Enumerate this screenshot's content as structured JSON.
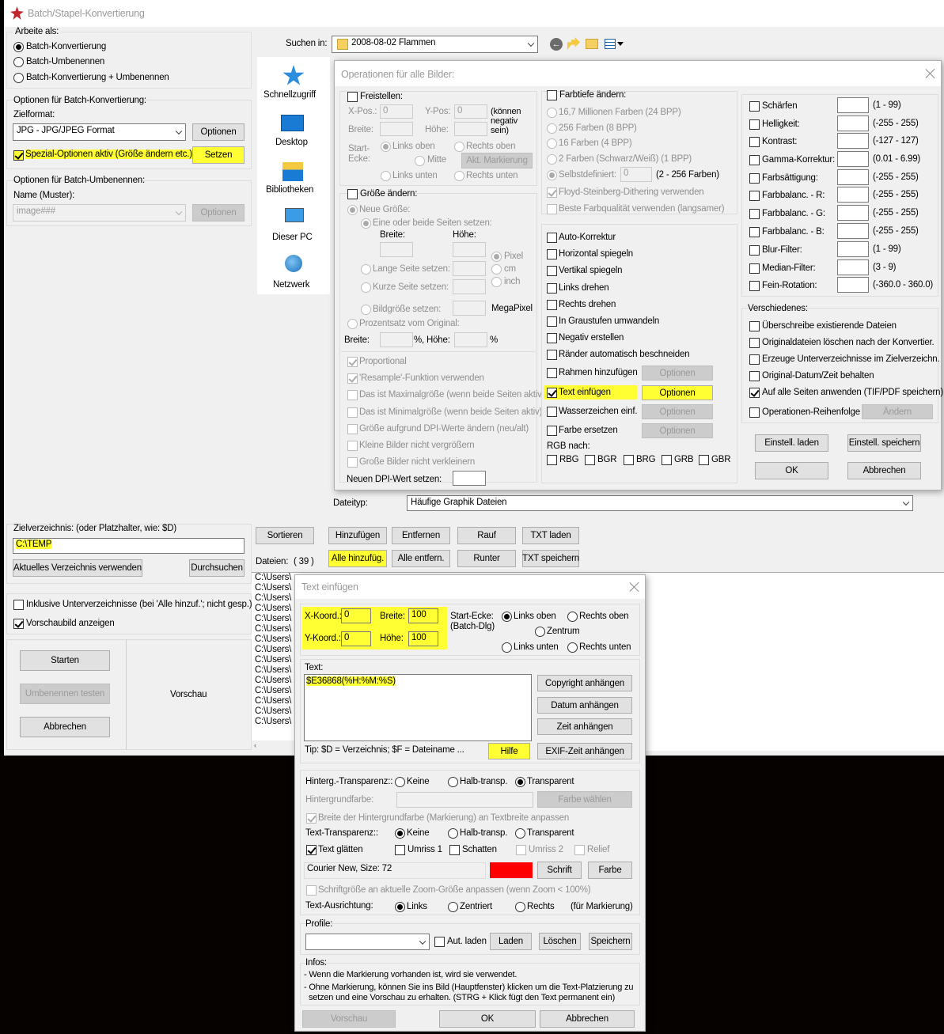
{
  "main": {
    "title": "Batch/Stapel-Konvertierung",
    "work_as_label": "Arbeite als:",
    "mode_convert": "Batch-Konvertierung",
    "mode_rename": "Batch-Umbenennen",
    "mode_both": "Batch-Konvertierung + Umbenennen",
    "conv_options_label": "Optionen für Batch-Konvertierung:",
    "target_format_label": "Zielformat:",
    "target_format_value": "JPG - JPG/JPEG Format",
    "options_btn": "Optionen",
    "special_options_label": "Spezial-Optionen aktiv (Größe ändern etc.)",
    "set_btn": "Setzen",
    "rename_options_label": "Optionen für Batch-Umbenennen:",
    "name_pattern_label": "Name (Muster):",
    "name_pattern_value": "image###",
    "options_btn2": "Optionen",
    "search_in_label": "Suchen in:",
    "search_in_value": "2008-08-02 Flammen",
    "nav": [
      "Schnellzugriff",
      "Desktop",
      "Bibliotheken",
      "Dieser PC",
      "Netzwerk"
    ],
    "filetype_label": "Dateityp:",
    "filetype_value": "Häufige Graphik Dateien",
    "target_dir_label": "Zielverzeichnis: (oder Platzhalter, wie: $D)",
    "target_dir_value": "C:\\TEMP",
    "use_current_dir_btn": "Aktuelles Verzeichnis verwenden",
    "browse_btn": "Durchsuchen",
    "include_subdirs": "Inklusive Unterverzeichnisse (bei 'Alle hinzuf.'; nicht gesp.)",
    "show_preview": "Vorschaubild anzeigen",
    "start_btn": "Starten",
    "test_rename_btn": "Umbenennen testen",
    "cancel_btn": "Abbrechen",
    "preview_label": "Vorschau",
    "sort_btn": "Sortieren",
    "add_btn": "Hinzufügen",
    "remove_btn": "Entfernen",
    "up_btn": "Rauf",
    "load_txt_btn": "TXT laden",
    "files_label": "Dateien:",
    "files_count": "( 39 )",
    "add_all_btn": "Alle hinzufüg.",
    "remove_all_btn": "Alle entfern.",
    "down_btn": "Runter",
    "save_txt_btn": "TXT speichern",
    "file_item": "C:\\Users\\"
  },
  "ops": {
    "title": "Operationen für alle Bilder:",
    "crop_label": "Freistellen:",
    "xpos": "X-Pos.:",
    "ypos": "Y-Pos:",
    "xval": "0",
    "yval": "0",
    "can_be_negative": "(können negativ sein)",
    "width": "Breite:",
    "height": "Höhe:",
    "start_corner": "Start-Ecke:",
    "top_left": "Links oben",
    "top_right": "Rechts oben",
    "center": "Mitte",
    "bottom_left": "Links unten",
    "bottom_right": "Rechts unten",
    "current_mark_btn": "Akt. Markierung",
    "resize_label": "Größe ändern:",
    "new_size": "Neue Größe:",
    "one_or_both": "Eine oder beide Seiten setzen:",
    "w2": "Breite:",
    "h2": "Höhe:",
    "pixel": "Pixel",
    "cm": "cm",
    "inch": "inch",
    "long_side": "Lange Seite setzen:",
    "short_side": "Kurze Seite setzen:",
    "image_size": "Bildgröße setzen:",
    "megapixel": "MegaPixel",
    "percent": "Prozentsatz vom Original:",
    "w3": "Breite:",
    "pct1": "%,",
    "h3": "Höhe:",
    "pct2": "%",
    "proportional": "Proportional",
    "resample": "'Resample'-Funktion verwenden",
    "is_max": "Das ist Maximalgröße (wenn beide Seiten aktiv",
    "is_min": "Das ist Minimalgröße (wenn beide Seiten aktiv)",
    "dpi_resize": "Größe aufgrund DPI-Werte ändern (neu/alt)",
    "no_enlarge": "Kleine Bilder nicht vergrößern",
    "no_shrink": "Große Bilder nicht verkleinern",
    "new_dpi": "Neuen DPI-Wert setzen:",
    "color_depth": "Farbtiefe ändern:",
    "c24": "16,7 Millionen Farben (24 BPP)",
    "c8": "256 Farben (8 BPP)",
    "c4": "16 Farben (4 BPP)",
    "c1": "2 Farben (Schwarz/Weiß) (1 BPP)",
    "custom": "Selbstdefiniert:",
    "custom_val": "0",
    "custom_range": "(2 - 256 Farben)",
    "dither": "Floyd-Steinberg-Dithering verwenden",
    "best_quality": "Beste Farbqualität verwenden (langsamer)",
    "auto_correct": "Auto-Korrektur",
    "flip_h": "Horizontal spiegeln",
    "flip_v": "Vertikal spiegeln",
    "rot_left": "Links drehen",
    "rot_right": "Rechts drehen",
    "grayscale": "In Graustufen umwandeln",
    "negative": "Negativ erstellen",
    "autocrop": "Ränder automatisch beschneiden",
    "add_frame": "Rahmen hinzufügen",
    "add_text": "Text einfügen",
    "watermark": "Wasserzeichen einf.",
    "replace_color": "Farbe ersetzen",
    "opt": "Optionen",
    "rgb_to": "RGB nach:",
    "rgb": [
      "RBG",
      "BGR",
      "BRG",
      "GRB",
      "GBR"
    ],
    "adjust": [
      {
        "label": "Schärfen",
        "range": "(1  -  99)"
      },
      {
        "label": "Helligkeit:",
        "range": "(-255  -  255)"
      },
      {
        "label": "Kontrast:",
        "range": "(-127  -  127)"
      },
      {
        "label": "Gamma-Korrektur:",
        "range": "(0.01  -  6.99)"
      },
      {
        "label": "Farbsättigung:",
        "range": "(-255  -  255)"
      },
      {
        "label": "Farbbalanc. - R:",
        "range": "(-255  -  255)"
      },
      {
        "label": "Farbbalanc. - G:",
        "range": "(-255  -  255)"
      },
      {
        "label": "Farbbalanc. - B:",
        "range": "(-255  -  255)"
      },
      {
        "label": "Blur-Filter:",
        "range": "(1  -  99)"
      },
      {
        "label": "Median-Filter:",
        "range": "(3  -  9)"
      },
      {
        "label": "Fein-Rotation:",
        "range": "(-360.0  -  360.0)"
      }
    ],
    "misc": "Verschiedenes:",
    "overwrite": "Überschreibe existierende Dateien",
    "delete_orig": "Originaldateien löschen nach der Konvertier.",
    "create_subdirs": "Erzeuge Unterverzeichnisse im Zielverzeichn.",
    "keep_date": "Original-Datum/Zeit behalten",
    "all_pages": "Auf alle Seiten anwenden (TIF/PDF speichern)",
    "op_order": "Operationen-Reihenfolge",
    "change_btn": "Ändern",
    "load_settings": "Einstell. laden",
    "save_settings": "Einstell. speichern",
    "ok": "OK",
    "cancel": "Abbrechen"
  },
  "text": {
    "title": "Text einfügen",
    "xk": "X-Koord.:",
    "xv": "0",
    "wk": "Breite:",
    "wv": "100",
    "yk": "Y-Koord.:",
    "yv": "0",
    "hk": "Höhe:",
    "hv": "100",
    "start_corner": "Start-Ecke:",
    "batch_dlg": "(Batch-Dlg)",
    "top_left": "Links oben",
    "top_right": "Rechts oben",
    "center": "Zentrum",
    "bottom_left": "Links unten",
    "bottom_right": "Rechts unten",
    "text_label": "Text:",
    "text_value": "$E36868(%H:%M:%S)",
    "copyright_btn": "Copyright anhängen",
    "date_btn": "Datum anhängen",
    "time_btn": "Zeit anhängen",
    "exif_btn": "EXIF-Zeit anhängen",
    "tip": "Tip: $D = Verzeichnis; $F = Dateiname ...",
    "help_btn": "Hilfe",
    "bg_transp": "Hinterg.-Transparenz::",
    "none": "Keine",
    "semi": "Halb-transp.",
    "transp": "Transparent",
    "bg_color": "Hintergrundfarbe:",
    "choose_color": "Farbe wählen",
    "fit_bg": "Breite der Hintergrundfarbe (Markierung) an Textbreite anpassen",
    "text_transp": "Text-Transparenz::",
    "smooth": "Text glätten",
    "outline1": "Umriss 1",
    "shadow": "Schatten",
    "outline2": "Umriss 2",
    "relief": "Relief",
    "font": "Courier New, Size: 72",
    "font_btn": "Schrift",
    "color_btn": "Farbe",
    "text_color": "#ff0000",
    "fit_zoom": "Schriftgröße an aktuelle Zoom-Größe anpassen (wenn Zoom < 100%)",
    "align": "Text-Ausrichtung:",
    "left": "Links",
    "centered": "Zentriert",
    "right": "Rechts",
    "for_mark": "(für Markierung)",
    "profiles": "Profile:",
    "autoload": "Aut. laden",
    "load": "Laden",
    "delete": "Löschen",
    "save": "Speichern",
    "info_label": "Infos:",
    "info1": "- Wenn die Markierung vorhanden ist, wird sie verwendet.",
    "info2": "- Ohne Markierung, können Sie ins Bild (Hauptfenster) klicken um die Text-Platzierung zu",
    "info3": "setzen und eine Vorschau zu erhalten. (STRG + Klick fügt den Text permanent ein)",
    "preview": "Vorschau",
    "ok": "OK",
    "cancel": "Abbrechen"
  }
}
